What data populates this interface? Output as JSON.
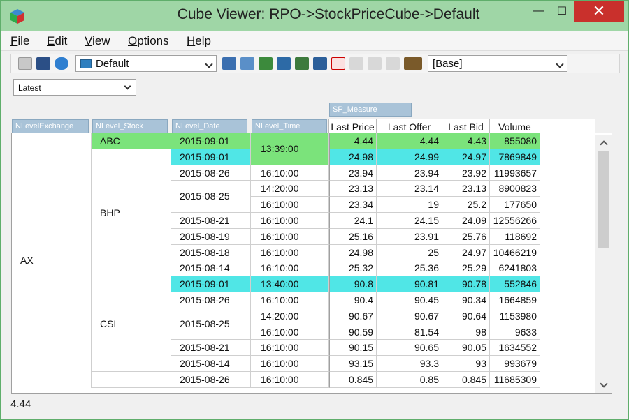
{
  "window": {
    "title": "Cube Viewer: RPO->StockPriceCube->Default"
  },
  "window_controls": {
    "minimize": "—",
    "maximize": "☐",
    "close": "✕"
  },
  "menu": {
    "items": [
      {
        "underlined": "F",
        "rest": "ile"
      },
      {
        "underlined": "E",
        "rest": "dit"
      },
      {
        "underlined": "V",
        "rest": "iew"
      },
      {
        "underlined": "O",
        "rest": "ptions"
      },
      {
        "underlined": "H",
        "rest": "elp"
      }
    ]
  },
  "toolbar": {
    "view_combo": "Default",
    "subset_combo": "[Base]"
  },
  "view_select": {
    "value": "Latest"
  },
  "column_dim": {
    "label": "SP_Measure"
  },
  "row_dims": [
    "NLevelExchange",
    "NLevel_Stock",
    "NLevel_Date",
    "NLevel_Time"
  ],
  "columns": [
    "Last Price",
    "Last Offer",
    "Last Bid",
    "Volume"
  ],
  "exchange": "AX",
  "stocks": [
    {
      "name": "ABC",
      "dates": [
        {
          "date": "2015-09-01",
          "times": [
            {
              "time": "13:39:00",
              "values": [
                "4.44",
                "4.44",
                "4.43",
                "855080"
              ]
            }
          ]
        }
      ]
    },
    {
      "name": "BHP",
      "dates": [
        {
          "date": "2015-09-01",
          "times": [
            {
              "time": "",
              "values": [
                "24.98",
                "24.99",
                "24.97",
                "7869849"
              ]
            }
          ]
        },
        {
          "date": "2015-08-26",
          "times": [
            {
              "time": "16:10:00",
              "values": [
                "23.94",
                "23.94",
                "23.92",
                "11993657"
              ]
            }
          ]
        },
        {
          "date": "2015-08-25",
          "times": [
            {
              "time": "14:20:00",
              "values": [
                "23.13",
                "23.14",
                "23.13",
                "8900823"
              ]
            },
            {
              "time": "16:10:00",
              "values": [
                "23.34",
                "19",
                "25.2",
                "177650"
              ]
            }
          ]
        },
        {
          "date": "2015-08-21",
          "times": [
            {
              "time": "16:10:00",
              "values": [
                "24.1",
                "24.15",
                "24.09",
                "12556266"
              ]
            }
          ]
        },
        {
          "date": "2015-08-19",
          "times": [
            {
              "time": "16:10:00",
              "values": [
                "25.16",
                "23.91",
                "25.76",
                "118692"
              ]
            }
          ]
        },
        {
          "date": "2015-08-18",
          "times": [
            {
              "time": "16:10:00",
              "values": [
                "24.98",
                "25",
                "24.97",
                "10466219"
              ]
            }
          ]
        },
        {
          "date": "2015-08-14",
          "times": [
            {
              "time": "16:10:00",
              "values": [
                "25.32",
                "25.36",
                "25.29",
                "6241803"
              ]
            }
          ]
        }
      ]
    },
    {
      "name": "CSL",
      "dates": [
        {
          "date": "2015-09-01",
          "times": [
            {
              "time": "13:40:00",
              "values": [
                "90.8",
                "90.81",
                "90.78",
                "552846"
              ]
            }
          ]
        },
        {
          "date": "2015-08-26",
          "times": [
            {
              "time": "16:10:00",
              "values": [
                "90.4",
                "90.45",
                "90.34",
                "1664859"
              ]
            }
          ]
        },
        {
          "date": "2015-08-25",
          "times": [
            {
              "time": "14:20:00",
              "values": [
                "90.67",
                "90.67",
                "90.64",
                "1153980"
              ]
            },
            {
              "time": "16:10:00",
              "values": [
                "90.59",
                "81.54",
                "98",
                "9633"
              ]
            }
          ]
        },
        {
          "date": "2015-08-21",
          "times": [
            {
              "time": "16:10:00",
              "values": [
                "90.15",
                "90.65",
                "90.05",
                "1634552"
              ]
            }
          ]
        },
        {
          "date": "2015-08-14",
          "times": [
            {
              "time": "16:10:00",
              "values": [
                "93.15",
                "93.3",
                "93",
                "993679"
              ]
            }
          ]
        }
      ]
    },
    {
      "name": "",
      "dates": [
        {
          "date": "2015-08-26",
          "times": [
            {
              "time": "16:10:00",
              "values": [
                "0.845",
                "0.85",
                "0.845",
                "11685309"
              ]
            }
          ]
        }
      ]
    }
  ],
  "highlighted_rows": [
    0,
    1,
    9
  ],
  "status": {
    "text": "4.44"
  },
  "colors": {
    "highlight_green": "#7be37b",
    "highlight_cyan": "#50e6e6",
    "header_blue": "#a9c3d8"
  }
}
